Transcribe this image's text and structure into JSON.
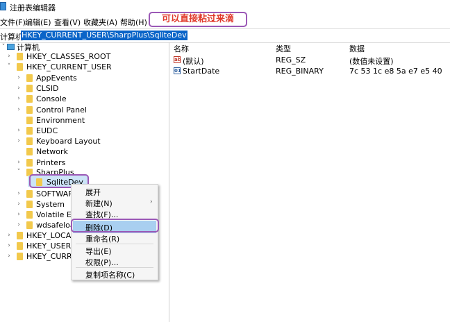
{
  "window": {
    "title": "注册表编辑器"
  },
  "menu": [
    "文件(F)",
    "编辑(E)",
    "查看(V)",
    "收藏夹(A)",
    "帮助(H)"
  ],
  "annotation": "可以直接粘过来滴",
  "address": {
    "prefix": "计算机\\",
    "path": "HKEY_CURRENT_USER\\SharpPlus\\SqliteDev"
  },
  "tree": {
    "root": "计算机",
    "hkcr": "HKEY_CLASSES_ROOT",
    "hkcu": "HKEY_CURRENT_USER",
    "children": [
      "AppEvents",
      "CLSID",
      "Console",
      "Control Panel",
      "Environment",
      "EUDC",
      "Keyboard Layout",
      "Network",
      "Printers",
      "SharpPlus"
    ],
    "selected": "SqliteDev",
    "after": [
      "SOFTWAR",
      "System",
      "Volatile E",
      "wdsafeloa"
    ],
    "hives": [
      "HKEY_LOCA",
      "HKEY_USERS",
      "HKEY_CURR"
    ]
  },
  "values": {
    "headers": {
      "name": "名称",
      "type": "类型",
      "data": "数据"
    },
    "rows": [
      {
        "name": "(默认)",
        "type": "REG_SZ",
        "data": "(数值未设置)",
        "icon": "string-value-icon"
      },
      {
        "name": "StartDate",
        "type": "REG_BINARY",
        "data": "7c 53 1c e8 5a e7 e5 40",
        "icon": "binary-value-icon"
      }
    ]
  },
  "context_menu": {
    "expand": "展开",
    "new": "新建(N)",
    "find": "查找(F)...",
    "delete": "删除(D)",
    "rename": "重命名(R)",
    "export": "导出(E)",
    "permissions": "权限(P)...",
    "copy_key_name": "复制项名称(C)"
  },
  "colors": {
    "accent": "#0a64c8",
    "annotation_border": "#9b59b6",
    "annotation_text": "#e0392b"
  }
}
